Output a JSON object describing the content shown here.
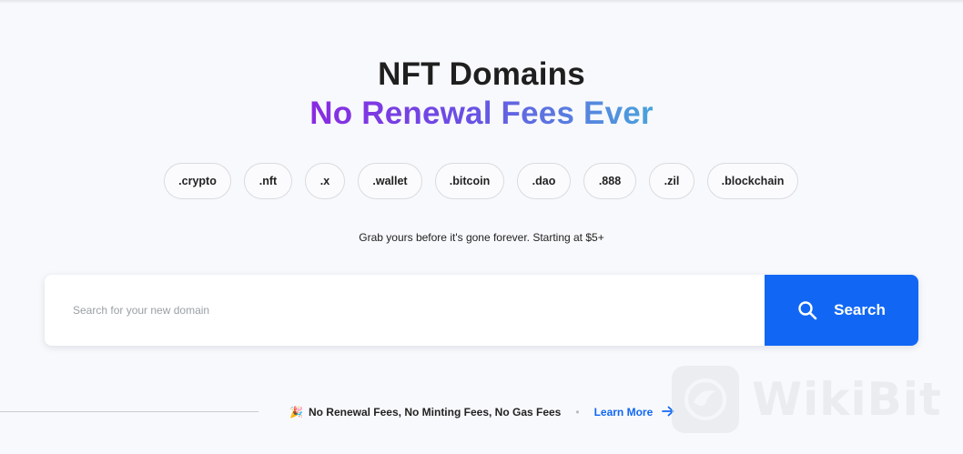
{
  "hero": {
    "title": "NFT Domains",
    "subtitle": "No Renewal Fees Ever"
  },
  "extensions": [
    ".crypto",
    ".nft",
    ".x",
    ".wallet",
    ".bitcoin",
    ".dao",
    ".888",
    ".zil",
    ".blockchain"
  ],
  "tagline": "Grab yours before it's gone forever. Starting at $5+",
  "search": {
    "placeholder": "Search for your new domain",
    "value": "",
    "button_label": "Search",
    "button_icon": "search-icon"
  },
  "footer": {
    "emoji": "🎉",
    "benefits": "No Renewal Fees, No Minting Fees, No Gas Fees",
    "separator": "•",
    "learn_more": "Learn More",
    "learn_more_icon": "arrow-right-icon"
  },
  "watermark": {
    "text": "WikiBit"
  },
  "colors": {
    "accent": "#1167f4",
    "gradient_start": "#8a2be2",
    "gradient_end": "#4aa3dc",
    "background": "#f8f9fc"
  }
}
